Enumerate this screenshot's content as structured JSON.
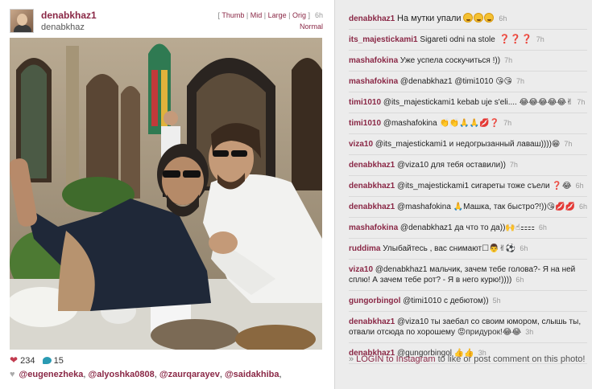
{
  "post": {
    "username": "denabkhaz1",
    "fullname": "denabkhaz",
    "sizes": {
      "thumb": "Thumb",
      "mid": "Mid",
      "large": "Large",
      "orig": "Orig",
      "time": "6h",
      "normal": "Normal"
    },
    "likes": "234",
    "comments_count": "15",
    "likers": [
      "@eugenezheka",
      "@alyoshka0808",
      "@zaurqarayev",
      "@saidakhiba"
    ]
  },
  "comments": [
    {
      "user": "denabkhaz1",
      "text": "На мутки упали",
      "emoji": "cry cry cry",
      "time": "6h"
    },
    {
      "user": "its_majestickami1",
      "text": "Sigareti odni na stole",
      "emoji": "❓❓❓",
      "time": "7h"
    },
    {
      "user": "mashafokina",
      "text": "Уже успела соскучиться !))",
      "emoji": "",
      "time": "7h"
    },
    {
      "user": "mashafokina",
      "text": "@denabkhaz1 @timi1010",
      "emoji": "😘😘",
      "time": "7h"
    },
    {
      "user": "timi1010",
      "text": "@its_majestickami1 kebab uje s'eli....",
      "emoji": "😂😂😂😂😂✌",
      "time": "7h"
    },
    {
      "user": "timi1010",
      "text": "@mashafokina",
      "emoji": "👏👏🙏🙏💋❓",
      "time": "7h"
    },
    {
      "user": "viza10",
      "text": "@its_majestickami1 и недогрызанный лаваш))))",
      "emoji": "😁",
      "time": "7h"
    },
    {
      "user": "denabkhaz1",
      "text": "@viza10 для тебя оставили))",
      "emoji": "",
      "time": "7h"
    },
    {
      "user": "denabkhaz1",
      "text": "@its_majestickami1 сигареты тоже съели",
      "emoji": "❓😂",
      "time": "6h"
    },
    {
      "user": "denabkhaz1",
      "text": "@mashafokina",
      "emoji2": "🙏",
      "text2": "Машка, так быстро?!))",
      "emoji": "😘💋💋",
      "time": "6h"
    },
    {
      "user": "mashafokina",
      "text": "@denabkhaz1 да что то да))",
      "emoji": "🙌☝⚏⚏",
      "time": "6h"
    },
    {
      "user": "ruddima",
      "text": "Улыбайтесь , вас снимают",
      "emoji": "☐👨✌⚽",
      "time": "6h"
    },
    {
      "user": "viza10",
      "text": "@denabkhaz1 мальчик, зачем тебе голова?- Я на ней сплю! А зачем тебе рот? - Я в него курю!))))",
      "emoji": "",
      "time": "6h"
    },
    {
      "user": "gungorbingol",
      "text": "@timi1010 с дебютом",
      "emoji": "))",
      "time": "5h"
    },
    {
      "user": "denabkhaz1",
      "text": "@viza10 ты заебал со своим юмором, слышь ты, отвали отсюда по хорошему",
      "emoji": "😡придурок!😂😂",
      "time": "3h"
    },
    {
      "user": "denabkhaz1",
      "text": "@gungorbingol",
      "emoji": "👍👍",
      "time": "3h"
    }
  ],
  "login": {
    "link": "LOGIN to Instagram",
    "rest": "to like or post comment on this photo!"
  }
}
